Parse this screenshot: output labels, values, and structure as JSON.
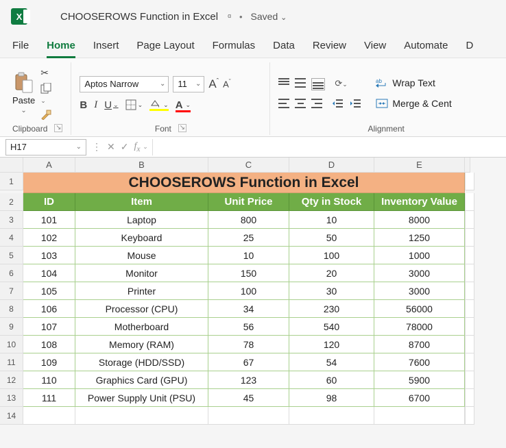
{
  "title": {
    "document": "CHOOSEROWS Function in Excel",
    "saved": "Saved"
  },
  "menu": {
    "file": "File",
    "home": "Home",
    "insert": "Insert",
    "page_layout": "Page Layout",
    "formulas": "Formulas",
    "data": "Data",
    "review": "Review",
    "view": "View",
    "automate": "Automate",
    "d": "D"
  },
  "ribbon": {
    "clipboard": {
      "paste": "Paste",
      "label": "Clipboard"
    },
    "font": {
      "name": "Aptos Narrow",
      "size": "11",
      "label": "Font",
      "bold": "B",
      "italic": "I",
      "underline": "U"
    },
    "alignment": {
      "label": "Alignment",
      "wrap": "Wrap Text",
      "merge": "Merge & Cent"
    }
  },
  "formula_bar": {
    "name_box": "H17"
  },
  "columns": [
    "A",
    "B",
    "C",
    "D",
    "E"
  ],
  "sheet_title": "CHOOSEROWS Function in Excel",
  "headers": [
    "ID",
    "Item",
    "Unit Price",
    "Qty in Stock",
    "Inventory Value"
  ],
  "chart_data": {
    "type": "table",
    "title": "CHOOSEROWS Function in Excel",
    "columns": [
      "ID",
      "Item",
      "Unit Price",
      "Qty in Stock",
      "Inventory Value"
    ],
    "rows": [
      [
        101,
        "Laptop",
        800,
        10,
        8000
      ],
      [
        102,
        "Keyboard",
        25,
        50,
        1250
      ],
      [
        103,
        "Mouse",
        10,
        100,
        1000
      ],
      [
        104,
        "Monitor",
        150,
        20,
        3000
      ],
      [
        105,
        "Printer",
        100,
        30,
        3000
      ],
      [
        106,
        "Processor (CPU)",
        34,
        230,
        56000
      ],
      [
        107,
        "Motherboard",
        56,
        540,
        78000
      ],
      [
        108,
        "Memory (RAM)",
        78,
        120,
        8700
      ],
      [
        109,
        "Storage (HDD/SSD)",
        67,
        54,
        7600
      ],
      [
        110,
        "Graphics Card (GPU)",
        123,
        60,
        5900
      ],
      [
        111,
        "Power Supply Unit (PSU)",
        45,
        98,
        6700
      ]
    ]
  }
}
